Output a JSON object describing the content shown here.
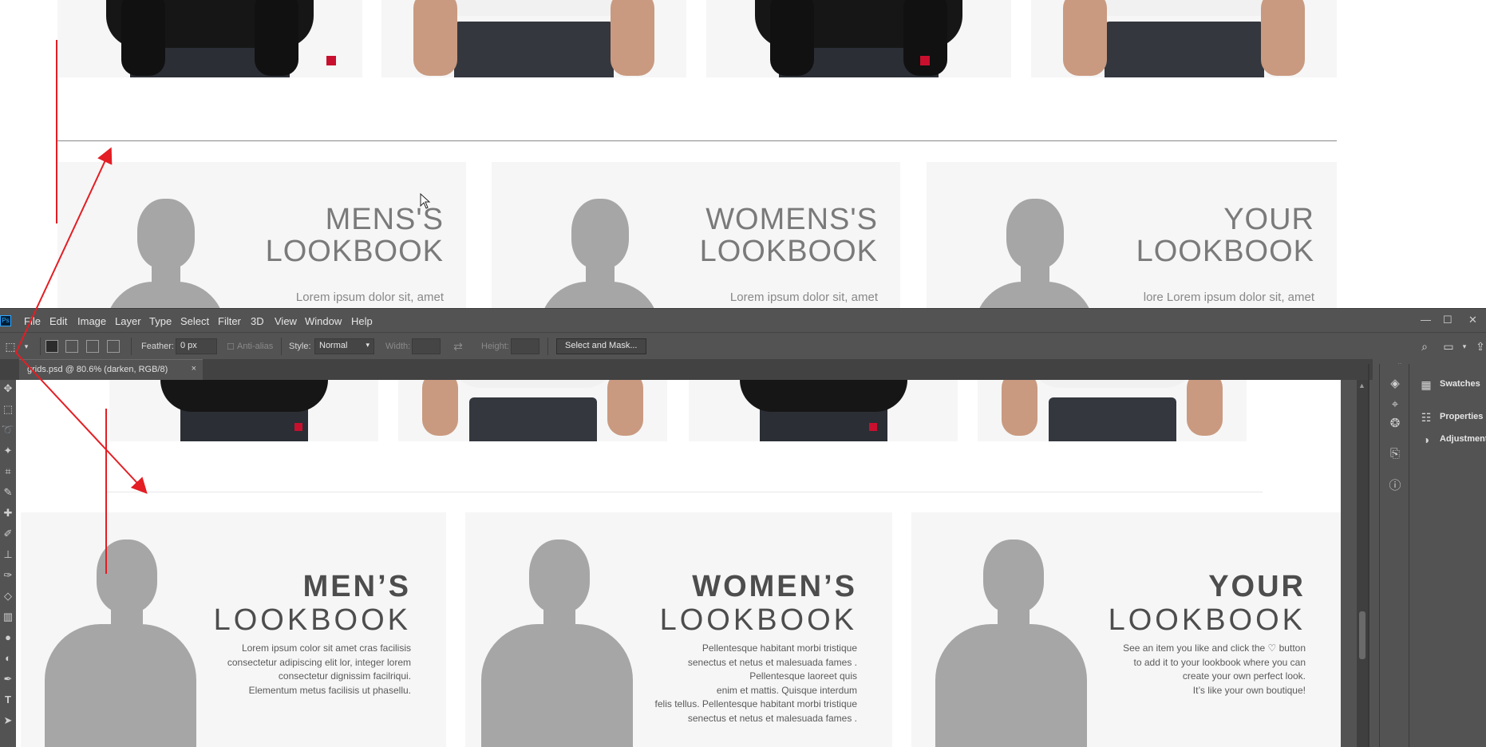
{
  "top_page": {
    "cards": [
      {
        "title_line1": "MENS'S",
        "title_line2": "LOOKBOOK",
        "subtitle": "Lorem ipsum dolor sit, amet"
      },
      {
        "title_line1": "WOMENS'S",
        "title_line2": "LOOKBOOK",
        "subtitle": "Lorem ipsum dolor sit, amet"
      },
      {
        "title_line1": "YOUR",
        "title_line2": "LOOKBOOK",
        "subtitle": "lore Lorem ipsum dolor sit, amet"
      }
    ]
  },
  "photoshop": {
    "logo": "Ps",
    "menu": [
      "File",
      "Edit",
      "Image",
      "Layer",
      "Type",
      "Select",
      "Filter",
      "3D",
      "View",
      "Window",
      "Help"
    ],
    "window_controls": {
      "minimize": "—",
      "maximize": "☐",
      "close": "✕"
    },
    "options": {
      "feather_label": "Feather:",
      "feather_value": "0 px",
      "antialias_label": "Anti-alias",
      "style_label": "Style:",
      "style_value": "Normal",
      "width_label": "Width:",
      "height_label": "Height:",
      "select_mask_button": "Select and Mask..."
    },
    "document_tab": {
      "title": "grids.psd @ 80.6% (darken, RGB/8)",
      "close": "×"
    },
    "panels": [
      {
        "icon": "swatches-icon",
        "label": "Swatches"
      },
      {
        "icon": "properties-icon",
        "label": "Properties"
      },
      {
        "icon": "adjustments-icon",
        "label": "Adjustments"
      }
    ],
    "panel_icons": [
      "layers-icon",
      "paths-icon",
      "channels-icon",
      "history-icon",
      "info-icon"
    ],
    "canvas": {
      "cards": [
        {
          "title_bold": "MEN’S",
          "title_thin": "LOOKBOOK",
          "body": [
            "Lorem ipsum color sit amet cras facilisis",
            "consectetur adipiscing elit lor, integer lorem",
            "consectetur dignissim facilriqui.",
            "Elementum metus facilisis ut phasellu."
          ]
        },
        {
          "title_bold": "WOMEN’S",
          "title_thin": "LOOKBOOK",
          "body": [
            "Pellentesque habitant morbi tristique",
            "senectus et netus et malesuada fames .",
            "Pellentesque laoreet quis",
            "enim et mattis. Quisque interdum",
            "felis tellus. Pellentesque habitant morbi tristique",
            "senectus et netus et malesuada fames ."
          ]
        },
        {
          "title_bold": "YOUR",
          "title_thin": "LOOKBOOK",
          "body": [
            "See an item you like and click the ♡ button",
            "to add it to your lookbook where you can",
            "create your own perfect look.",
            "It’s like your own boutique!"
          ]
        }
      ]
    }
  },
  "colors": {
    "annotation_red": "#e31e24",
    "ps_bg": "#535353",
    "silhouette": "#a6a6a6",
    "card_bg": "#f6f6f6"
  }
}
